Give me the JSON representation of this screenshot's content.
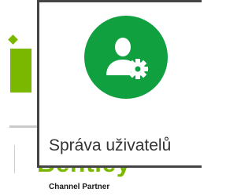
{
  "tile": {
    "label": "Správa uživatelů",
    "icon": "user-settings-icon",
    "accent_color": "#10a040"
  },
  "background_brand": {
    "name": "Bentley",
    "tagline": "Channel Partner",
    "brand_color": "#7ab800"
  }
}
